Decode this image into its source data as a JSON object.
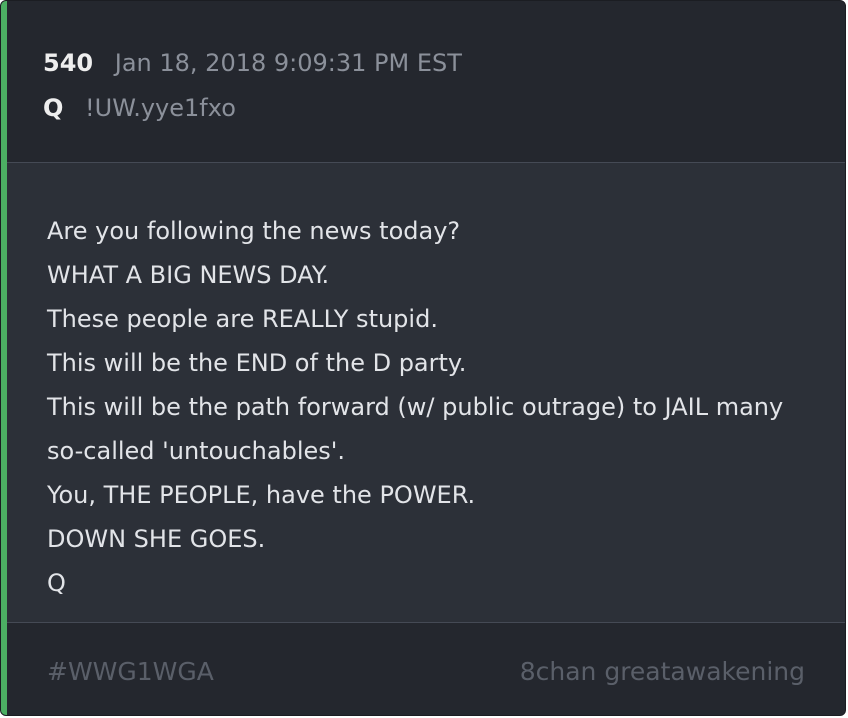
{
  "post": {
    "number": "540",
    "date": "Jan 18, 2018 9:09:31 PM EST",
    "author": "Q",
    "tripcode": "!UW.yye1fxo",
    "lines": [
      "Are you following the news today?",
      "WHAT A BIG NEWS DAY.",
      "These people are REALLY stupid.",
      "This will be the END of the D party.",
      "This will be the path forward (w/ public outrage) to JAIL many",
      "so-called 'untouchables'.",
      "You, THE PEOPLE, have the POWER.",
      "DOWN SHE GOES.",
      "Q"
    ]
  },
  "footer": {
    "hashtag": "#WWG1WGA",
    "source": "8chan greatawakening"
  },
  "colors": {
    "accent": "#4caf63",
    "card_background": "#2c3038",
    "header_background": "#24272e",
    "text": "#e2e4e8",
    "muted_text": "#8b909a"
  }
}
